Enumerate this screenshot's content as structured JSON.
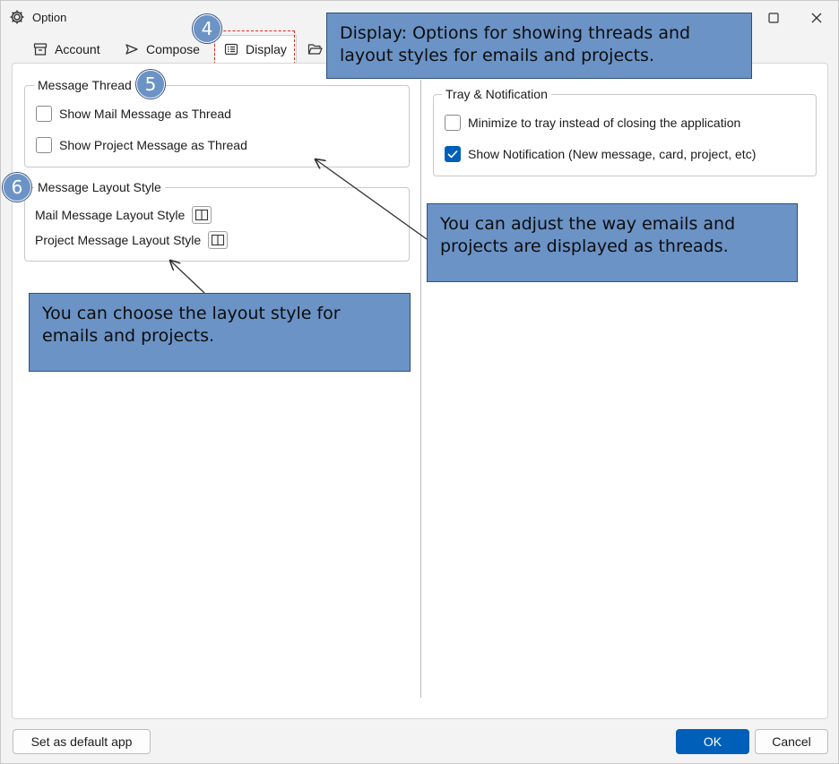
{
  "window": {
    "title": "Option",
    "icon": "gear-icon"
  },
  "tabs": [
    {
      "label": "Account",
      "icon": "archive-box-icon"
    },
    {
      "label": "Compose",
      "icon": "send-icon"
    },
    {
      "label": "Display",
      "icon": "display-list-icon",
      "active": true
    },
    {
      "label": "",
      "icon": "folder-open-icon"
    }
  ],
  "message_thread": {
    "legend": "Message Thread",
    "options": [
      {
        "label": "Show Mail Message as Thread",
        "checked": false
      },
      {
        "label": "Show Project Message as Thread",
        "checked": false
      }
    ]
  },
  "message_layout_style": {
    "legend": "Message Layout Style",
    "rows": [
      {
        "label": "Mail Message Layout Style",
        "icon": "split-layout-icon"
      },
      {
        "label": "Project Message Layout Style",
        "icon": "split-layout-icon"
      }
    ]
  },
  "tray_notification": {
    "legend": "Tray & Notification",
    "options": [
      {
        "label": "Minimize to tray instead of closing the application",
        "checked": false
      },
      {
        "label": "Show Notification (New message, card, project, etc)",
        "checked": true
      }
    ]
  },
  "footer": {
    "default_app_label": "Set as default app",
    "ok_label": "OK",
    "cancel_label": "Cancel"
  },
  "annotations": {
    "badges": [
      "4",
      "5",
      "6"
    ],
    "callout_display": "Display: Options for showing threads and layout styles for emails and projects.",
    "callout_threads": "You can adjust the way emails and projects are displayed as threads.",
    "callout_layout": "You can choose the layout style for emails and projects."
  },
  "colors": {
    "accent": "#005fb8",
    "callout_bg": "#6b93c6",
    "highlight_border": "#e0281e"
  }
}
